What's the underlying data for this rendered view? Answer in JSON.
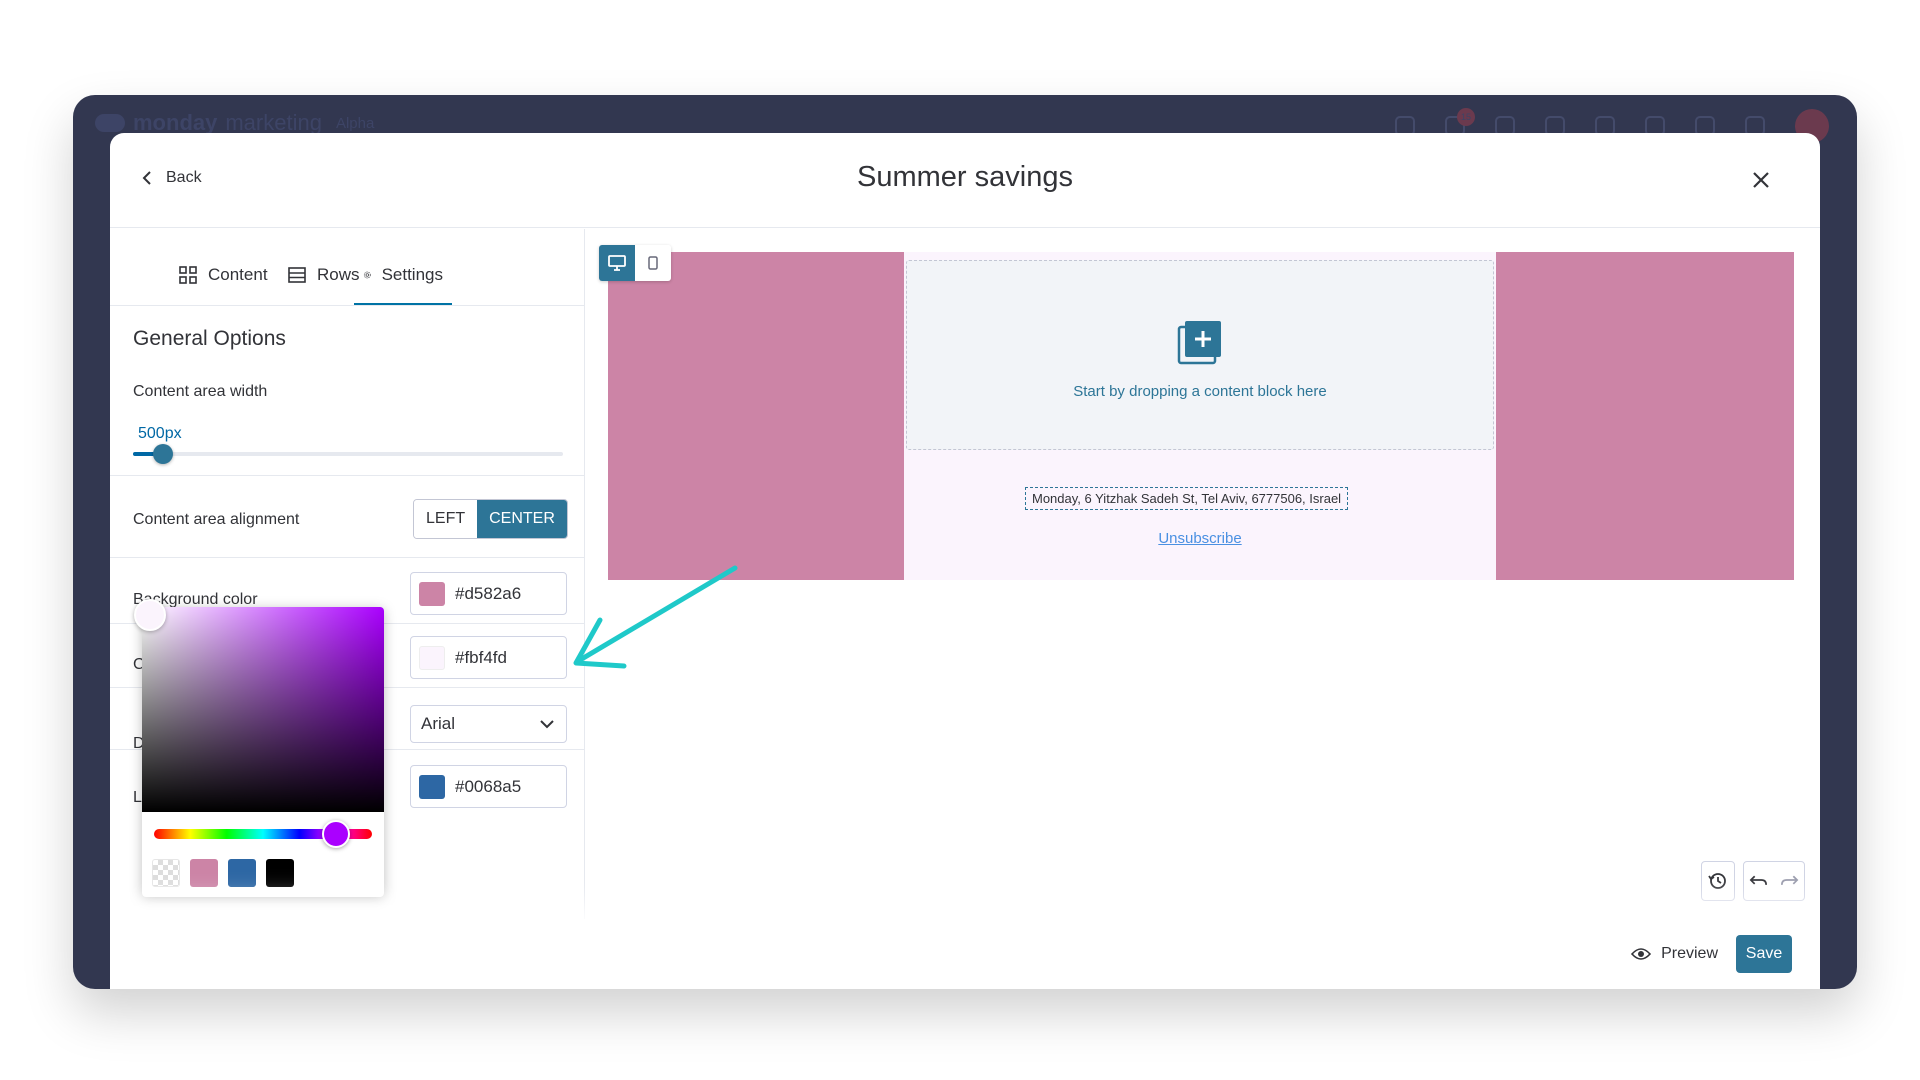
{
  "app": {
    "brand_name": "monday",
    "brand_product": "marketing",
    "brand_tag": "Alpha",
    "notification_count": "15"
  },
  "modal": {
    "title": "Summer savings",
    "back_label": "Back"
  },
  "tabs": [
    {
      "label": "Content",
      "icon": "grid-icon"
    },
    {
      "label": "Rows",
      "icon": "rows-icon"
    },
    {
      "label": "Settings",
      "icon": "gear-icon"
    }
  ],
  "settings": {
    "section_title": "General Options",
    "content_width_label": "Content area width",
    "content_width_value": "500px",
    "content_width_fraction": 0.07,
    "alignment_label": "Content area alignment",
    "align_left": "LEFT",
    "align_center": "CENTER",
    "background_label": "Background color",
    "background_value": "#d582a6",
    "content_bg_label": "Co",
    "content_bg_value": "#fbf4fd",
    "font_label": "De",
    "font_value": "Arial",
    "link_label": "Li",
    "link_value": "#0068a5"
  },
  "picker": {
    "presets": [
      "transparent",
      "#cc84a6",
      "#2d67a4",
      "#000000"
    ]
  },
  "canvas": {
    "drop_text": "Start by dropping a content block here",
    "address": "Monday, 6 Yitzhak Sadeh St, Tel Aviv, 6777506, Israel",
    "unsubscribe": "Unsubscribe",
    "outer_color": "#cc84a6",
    "content_color": "#fbf4fd"
  },
  "footer": {
    "preview_label": "Preview",
    "save_label": "Save"
  },
  "colors": {
    "accent": "#2d7597",
    "link": "#0068a5",
    "annotation_arrow": "#1fc9c9"
  }
}
